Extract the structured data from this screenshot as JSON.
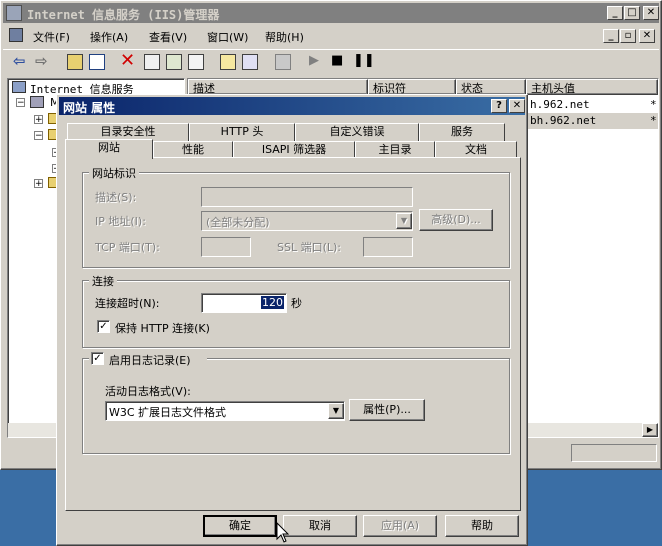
{
  "main_window": {
    "title": "Internet 信息服务 (IIS)管理器",
    "menu": [
      "文件(F)",
      "操作(A)",
      "查看(V)",
      "窗口(W)",
      "帮助(H)"
    ],
    "tree_root": "Internet 信息服务",
    "tree_item_m": "M",
    "columns": [
      "描述",
      "标识符",
      "状态",
      "主机头值"
    ],
    "rows": [
      {
        "host": "h.962.net",
        "mark": "*"
      },
      {
        "host": "bh.962.net",
        "mark": "*"
      }
    ]
  },
  "dialog": {
    "title": "网站 属性",
    "help_btn": "?",
    "close_btn": "✕",
    "tabs_back": [
      "目录安全性",
      "HTTP 头",
      "自定义错误",
      "服务"
    ],
    "tabs_front": [
      "网站",
      "性能",
      "ISAPI 筛选器",
      "主目录",
      "文档"
    ],
    "site_id": {
      "legend": "网站标识",
      "desc_label": "描述(S):",
      "ip_label": "IP 地址(I):",
      "ip_value": "(全部未分配)",
      "advanced_btn": "高级(D)...",
      "tcp_label": "TCP 端口(T):",
      "ssl_label": "SSL 端口(L):"
    },
    "connection": {
      "legend": "连接",
      "timeout_label": "连接超时(N):",
      "timeout_value": "120",
      "timeout_unit": "秒",
      "keepalive_label": "保持 HTTP 连接(K)",
      "keepalive_checked": "✓"
    },
    "logging": {
      "enable_label": "启用日志记录(E)",
      "enable_checked": "✓",
      "format_label": "活动日志格式(V):",
      "format_value": "W3C 扩展日志文件格式",
      "props_btn": "属性(P)..."
    },
    "buttons": {
      "ok": "确定",
      "cancel": "取消",
      "apply": "应用(A)",
      "help": "帮助"
    }
  }
}
